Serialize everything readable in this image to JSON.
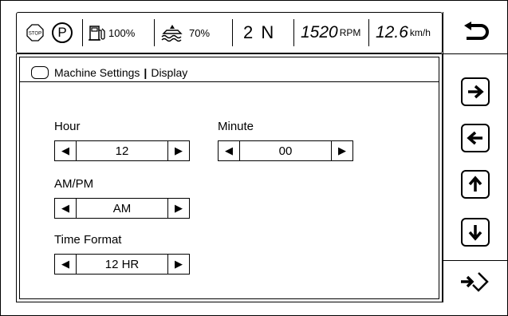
{
  "status": {
    "stop_label": "STOP",
    "park_label": "P",
    "fuel_value": "100%",
    "def_value": "70%",
    "gear": "2 N",
    "rpm_value": "1520",
    "rpm_unit": "RPM",
    "speed_value": "12.6",
    "speed_unit": "km/h"
  },
  "panel": {
    "breadcrumb_main": "Machine Settings",
    "breadcrumb_sep": "|",
    "breadcrumb_sub": "Display"
  },
  "fields": {
    "hour": {
      "label": "Hour",
      "value": "12"
    },
    "minute": {
      "label": "Minute",
      "value": "00"
    },
    "ampm": {
      "label": "AM/PM",
      "value": "AM"
    },
    "time_format": {
      "label": "Time Format",
      "value": "12 HR"
    }
  },
  "icons": {
    "back": "back-arrow-icon",
    "right": "arrow-right-icon",
    "left": "arrow-left-icon",
    "up": "arrow-up-icon",
    "down": "arrow-down-icon",
    "enter": "enter-icon"
  }
}
